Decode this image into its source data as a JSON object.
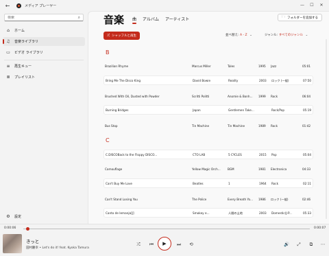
{
  "window": {
    "title": "メディア プレーヤー",
    "back_icon": "←",
    "controls": [
      "—",
      "☐",
      "✕"
    ]
  },
  "sidebar": {
    "search_placeholder": "検索",
    "items": [
      {
        "label": "ホーム",
        "icon": "⌂"
      },
      {
        "label": "音楽ライブラリ",
        "icon": "♫"
      },
      {
        "label": "ビデオ ライブラリ",
        "icon": "▭"
      },
      {
        "label": "再生キュー",
        "icon": "≡"
      },
      {
        "label": "プレイリスト",
        "icon": "≣"
      }
    ],
    "settings_label": "設定",
    "settings_icon": "⚙"
  },
  "main": {
    "heading": "音楽",
    "tabs": [
      "曲",
      "アルバム",
      "アーティスト"
    ],
    "add_folder_label": "フォルダーを追加する",
    "shuffle_label": "シャッフルと再生",
    "sort_label": "並べ替え:",
    "sort_value": "A - Z",
    "genre_label": "ジャンル:",
    "genre_value": "すべてのジャンル",
    "sections": [
      {
        "letter": "B",
        "rows": [
          {
            "title": "Brazilian Rhyme",
            "artist": "Marcus Miller",
            "album": "Tales",
            "year": "1995",
            "genre": "Jazz",
            "duration": "05:01"
          },
          {
            "title": "Bring Me The Disco King",
            "artist": "David Bowie",
            "album": "Reality",
            "year": "2003",
            "genre": "ロック (一般)",
            "duration": "07:50"
          },
          {
            "title": "Brushed With Oil, Dusted with Powder",
            "artist": "Scritti Politti",
            "album": "Anomie & Bonh...",
            "year": "1999",
            "genre": "Rock",
            "duration": "06:04"
          },
          {
            "title": "Burning Bridges",
            "artist": "Japan",
            "album": "Gentlemen Take...",
            "year": "",
            "genre": "Rock/Pop",
            "duration": "05:19"
          },
          {
            "title": "Bus Stop",
            "artist": "Tin Machine",
            "album": "Tin Machine",
            "year": "1989",
            "genre": "Rock",
            "duration": "01:42"
          }
        ]
      },
      {
        "letter": "C",
        "rows": [
          {
            "title": "C.DISCOBack to the Floppy DISCO...",
            "artist": "CTO LAB",
            "album": "5  CYCLES",
            "year": "2015",
            "genre": "Pop",
            "duration": "05:04"
          },
          {
            "title": "Camouflage",
            "artist": "Yellow Magic Orch...",
            "album": "BGM",
            "year": "1981",
            "genre": "Electronica",
            "duration": "04:33"
          },
          {
            "title": "Can't Buy Me Love",
            "artist": "Beatles",
            "album": "1",
            "year": "1964",
            "genre": "Rock",
            "duration": "02:11"
          },
          {
            "title": "Can't Stand Losing You",
            "artist": "The Police",
            "album": "Every Breath Yo...",
            "year": "1986",
            "genre": "ロック (一般)",
            "duration": "02:46"
          },
          {
            "title": "Canto  de  Iemanja[J]",
            "artist": "Smokey  e...",
            "album": "人間の土地",
            "year": "2003",
            "genre": "Domestic(J-P...",
            "duration": "05:33"
          }
        ]
      }
    ]
  },
  "player": {
    "elapsed": "0:00:06",
    "total": "0:00:07",
    "progress": 0.01,
    "song_title": "きっと",
    "song_subtitle": "田村慶幸 • Let's do it! feat. Kyoka Tamura",
    "icons": {
      "shuffle": "⤮",
      "prev": "⏮",
      "play": "▶",
      "next": "⏭",
      "repeat": "⟲",
      "volume": "🔊",
      "fullscreen": "⤢",
      "miniplayer": "⧉",
      "more": "⋯"
    }
  }
}
